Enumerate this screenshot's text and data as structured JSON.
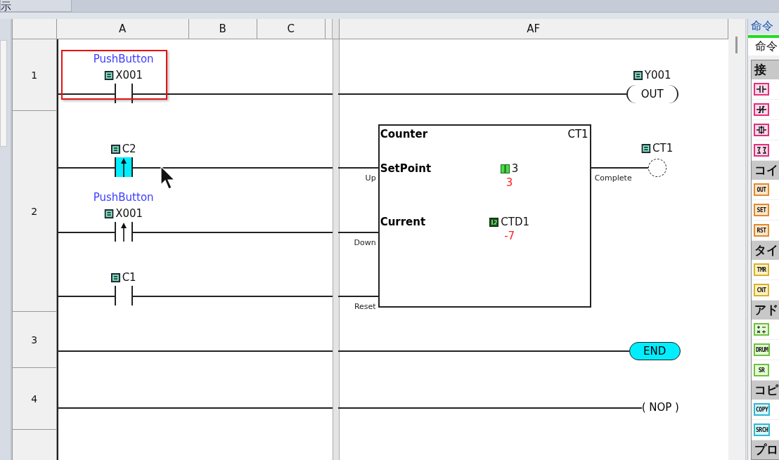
{
  "top_tab": {
    "label": "示"
  },
  "columns": [
    "A",
    "B",
    "C",
    "AF"
  ],
  "row_numbers": [
    "1",
    "2",
    "3",
    "4"
  ],
  "rungs": [
    {
      "contacts": [
        {
          "kind": "normal",
          "comment": "PushButton",
          "tag": "X001",
          "active": false,
          "selected": true
        }
      ],
      "outputs": [
        {
          "kind": "out",
          "tag": "Y001",
          "text": "OUT"
        }
      ]
    },
    {
      "contacts": [
        {
          "kind": "rising",
          "tag": "C2",
          "active": true,
          "selected": false
        },
        {
          "kind": "rising",
          "comment": "PushButton",
          "tag": "X001",
          "active": false,
          "selected": false
        },
        {
          "kind": "normal",
          "tag": "C1",
          "active": false,
          "selected": false
        }
      ],
      "counter": {
        "title": "Counter",
        "name": "CT1",
        "setpoint_label": "SetPoint",
        "setpoint_tag": "3",
        "setpoint_value": "3",
        "current_label": "Current",
        "current_tag": "CTD1",
        "current_value": "-7",
        "inputs": [
          "Up",
          "Down",
          "Reset"
        ],
        "output": "Complete"
      },
      "outputs": [
        {
          "kind": "coil",
          "tag": "CT1"
        }
      ]
    },
    {
      "outputs": [
        {
          "kind": "end",
          "text": "END"
        }
      ]
    },
    {
      "outputs": [
        {
          "kind": "nop",
          "text": "( NOP )"
        }
      ]
    }
  ],
  "palette": {
    "tab": "命令",
    "subtab": "命令",
    "groups": [
      {
        "title": "接",
        "items": [
          {
            "kind": "contact-no",
            "color": "#e0307a"
          },
          {
            "kind": "contact-nc",
            "color": "#e0307a"
          },
          {
            "kind": "contact-edge",
            "color": "#e0307a"
          },
          {
            "kind": "contact-compare",
            "color": "#e0307a"
          }
        ]
      },
      {
        "title": "コイ",
        "items": [
          {
            "kind": "coil",
            "label": "OUT",
            "color": "#e08a30"
          },
          {
            "kind": "coil",
            "label": "SET",
            "color": "#e08a30"
          },
          {
            "kind": "coil",
            "label": "RST",
            "color": "#e08a30"
          }
        ]
      },
      {
        "title": "タイ",
        "items": [
          {
            "kind": "text",
            "label": "TMR",
            "color": "#d8b030"
          },
          {
            "kind": "text",
            "label": "CNT",
            "color": "#d8b030"
          }
        ]
      },
      {
        "title": "アド",
        "items": [
          {
            "kind": "math",
            "color": "#70c040"
          },
          {
            "kind": "text",
            "label": "DRUM",
            "color": "#70c040"
          },
          {
            "kind": "text",
            "label": "SR",
            "color": "#70c040"
          }
        ]
      },
      {
        "title": "コピ",
        "items": [
          {
            "kind": "text",
            "label": "COPY",
            "color": "#30b8d0"
          },
          {
            "kind": "text",
            "label": "SRCH",
            "color": "#30b8d0"
          }
        ]
      },
      {
        "title": "プロ"
      }
    ]
  }
}
